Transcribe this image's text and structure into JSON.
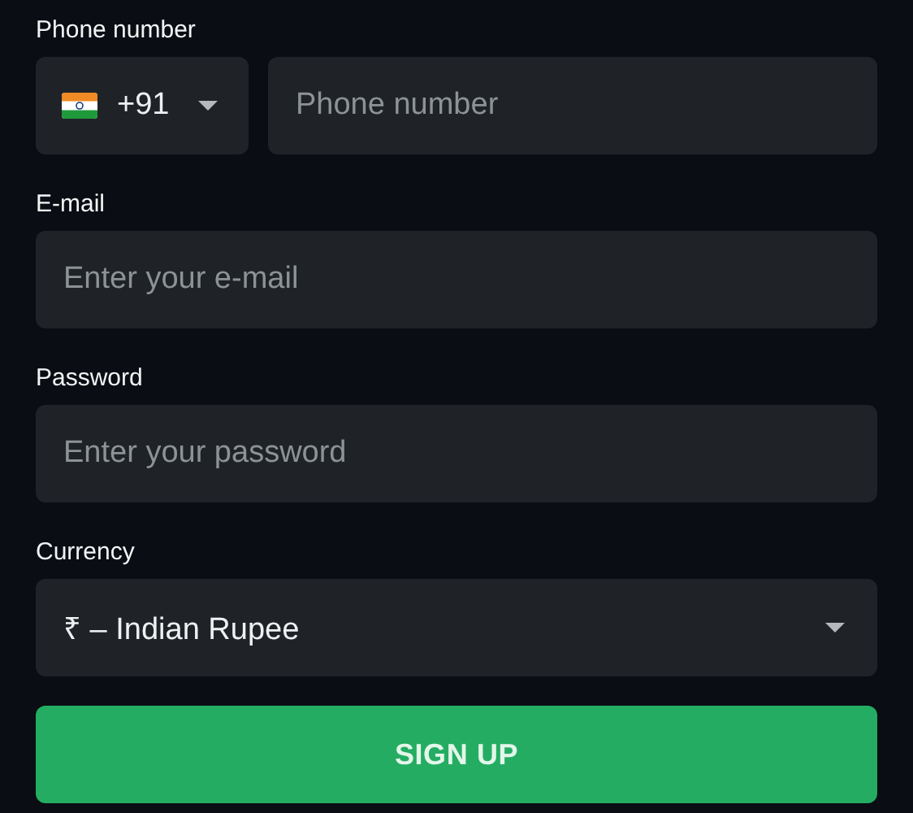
{
  "fields": [
    {
      "kind": "phone",
      "label": "Phone number",
      "country_code": "+91",
      "placeholder": "Phone number"
    },
    {
      "kind": "text",
      "label": "E-mail",
      "placeholder": "Enter your e-mail"
    },
    {
      "kind": "text",
      "label": "Password",
      "placeholder": "Enter your password"
    },
    {
      "kind": "select",
      "label": "Currency",
      "value": "₹ – Indian Rupee"
    }
  ],
  "submit": "SIGN UP"
}
